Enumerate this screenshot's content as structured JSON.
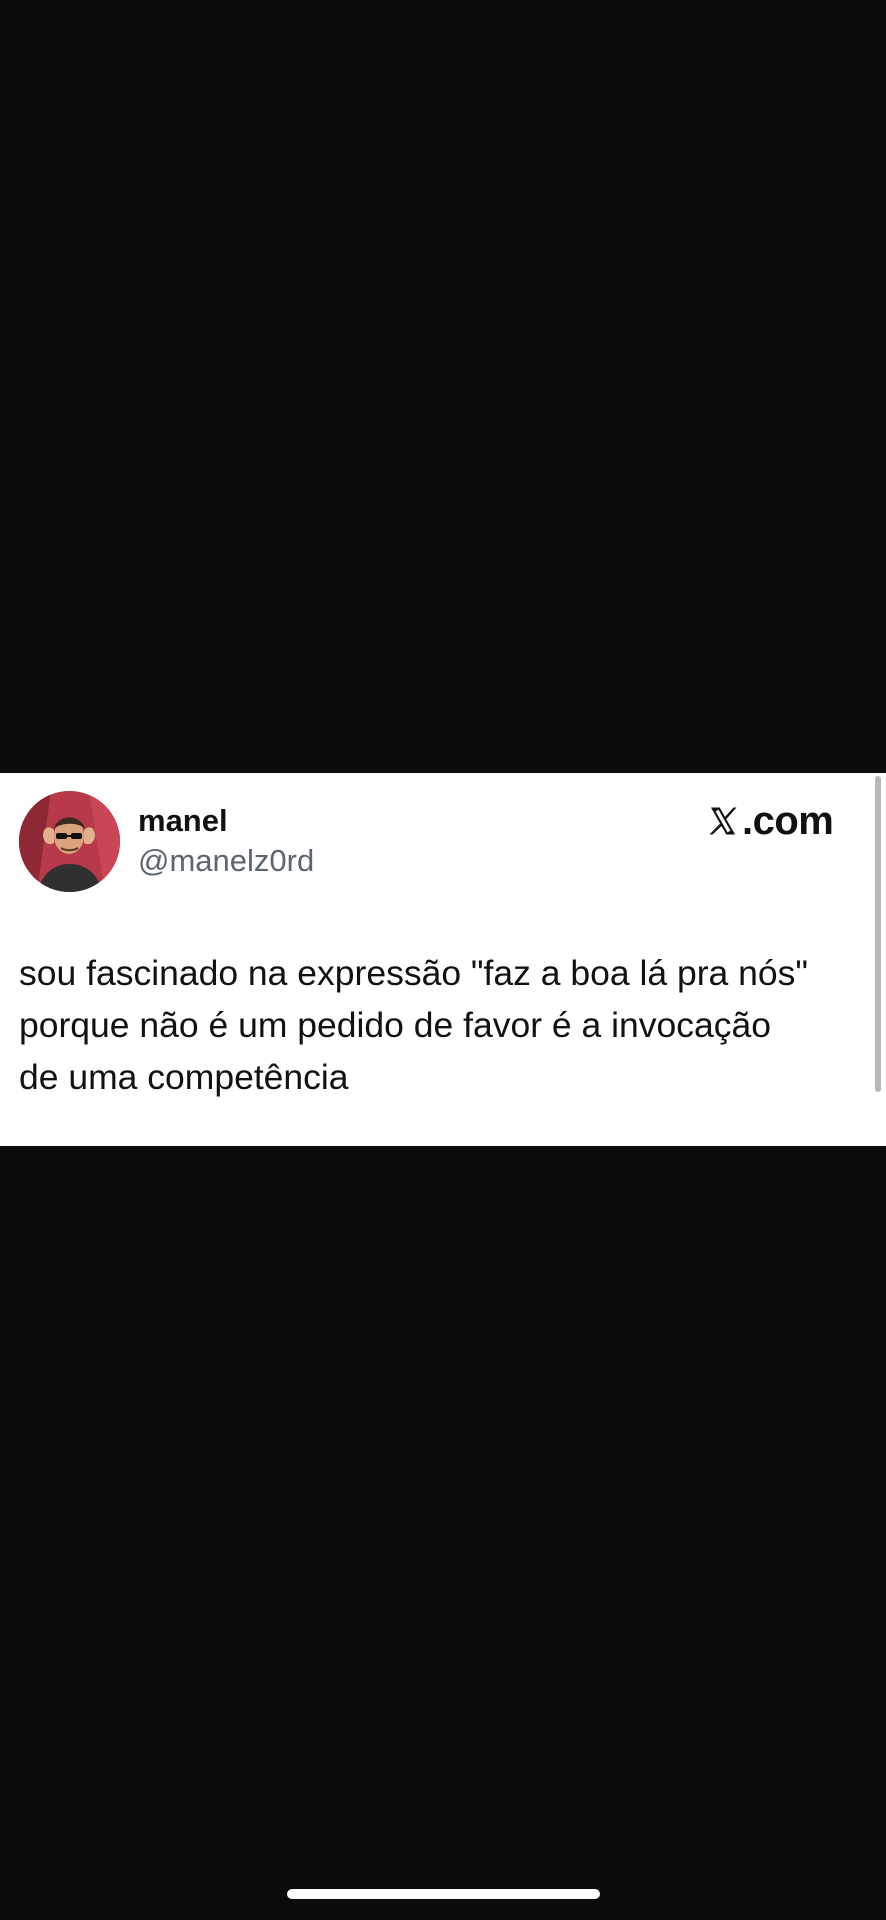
{
  "tweet": {
    "display_name": "manel",
    "handle": "@manelz0rd",
    "source_icon": "x-logo-icon",
    "source_label": ".com",
    "text_lines": [
      "sou fascinado na expressão \"faz a boa lá pra nós\"",
      "porque não é um pedido de favor é a invocação",
      "de uma competência"
    ]
  },
  "colors": {
    "background": "#0b0b0b",
    "card_background": "#ffffff",
    "text": "#111111",
    "handle": "#5b6670",
    "avatar_background": "#b7394a",
    "home_indicator": "#ffffff"
  }
}
